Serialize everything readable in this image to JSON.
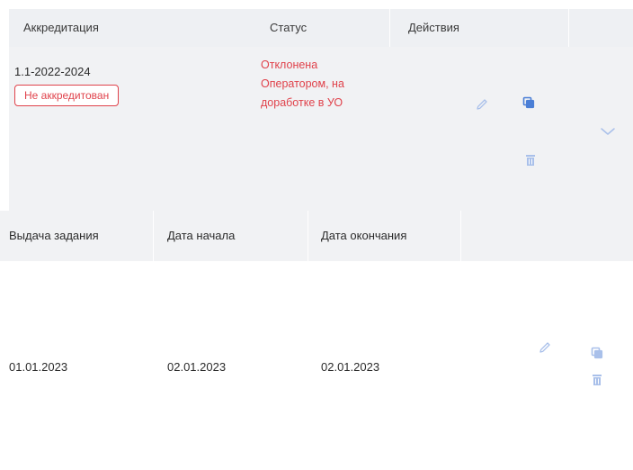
{
  "main_table": {
    "headers": {
      "accreditation": "Аккредитация",
      "status": "Статус",
      "actions": "Действия"
    },
    "row": {
      "accreditation_code": "1.1-2022-2024",
      "accreditation_badge": "Не аккредитован",
      "status_lines": [
        "Отклонена",
        "Оператором, на",
        "доработке в УО"
      ],
      "expanded": true
    }
  },
  "sub_table": {
    "headers": {
      "issue": "Выдача задания",
      "start_date": "Дата начала",
      "end_date": "Дата окончания"
    },
    "row": {
      "issue": "01.01.2023",
      "start_date": "02.01.2023",
      "end_date": "02.01.2023"
    }
  },
  "icons": {
    "edit": "pencil-icon",
    "copy": "copy-icon",
    "delete": "trash-icon",
    "expand": "chevron-down-icon"
  },
  "colors": {
    "accent_blue": "#4b7fd6",
    "icon_light_blue": "#a9c0ea",
    "error_red": "#e0424b",
    "header_bg": "#eef0f3",
    "row_bg": "#f1f2f4"
  }
}
